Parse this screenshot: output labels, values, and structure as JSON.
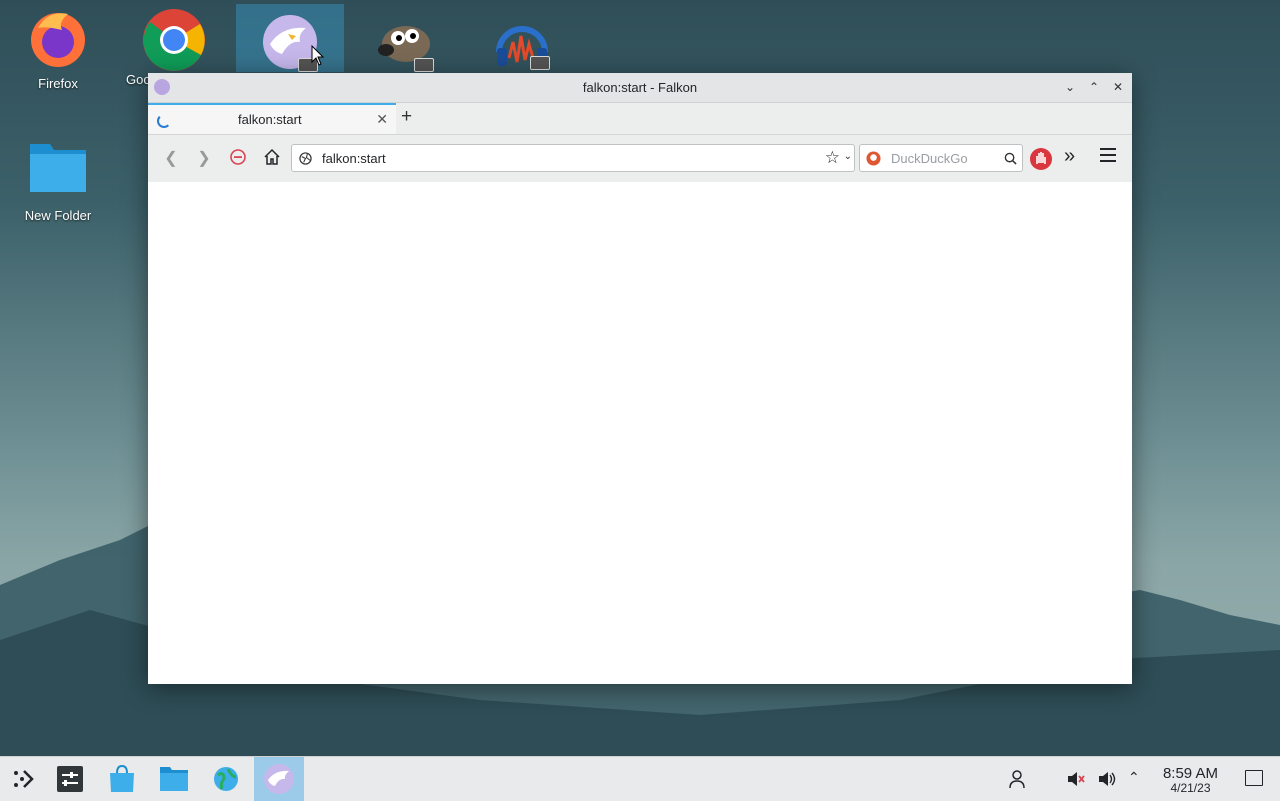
{
  "desktop": {
    "icons": [
      {
        "label": "Firefox",
        "icon": "firefox-icon"
      },
      {
        "label": "Goo",
        "icon": "chrome-icon"
      },
      {
        "label": "",
        "icon": "falkon-icon"
      },
      {
        "label": "",
        "icon": "gimp-icon"
      },
      {
        "label": "",
        "icon": "audacity-icon"
      },
      {
        "label": "New Folder",
        "icon": "folder-icon"
      }
    ]
  },
  "window": {
    "title": "falkon:start - Falkon",
    "tab": {
      "title": "falkon:start"
    },
    "url": "falkon:start",
    "search": {
      "placeholder": "DuckDuckGo",
      "engine": "duckduckgo-icon"
    }
  },
  "taskbar": {
    "time": "8:59 AM",
    "date": "4/21/23"
  },
  "colors": {
    "accent": "#3daee9",
    "taskbar": "#e8eaec"
  }
}
